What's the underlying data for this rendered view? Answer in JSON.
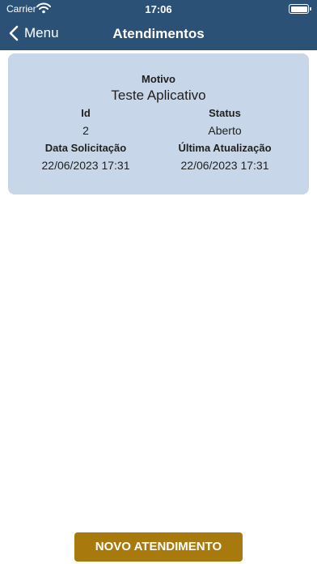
{
  "status_bar": {
    "carrier": "Carrier",
    "time": "17:06"
  },
  "nav": {
    "back_label": "Menu",
    "title": "Atendimentos"
  },
  "ticket": {
    "motivo_label": "Motivo",
    "motivo_value": "Teste Aplicativo",
    "id_label": "Id",
    "id_value": "2",
    "status_label": "Status",
    "status_value": "Aberto",
    "data_label": "Data Solicitação",
    "data_value": "22/06/2023 17:31",
    "update_label": "Última Atualização",
    "update_value": "22/06/2023 17:31"
  },
  "footer": {
    "button_label": "NOVO ATENDIMENTO"
  },
  "colors": {
    "header": "#2b5276",
    "card": "#c7d6e8",
    "button": "#a87a0d"
  },
  "icons": [
    "wifi-icon",
    "battery-icon",
    "back-chevron-icon"
  ]
}
